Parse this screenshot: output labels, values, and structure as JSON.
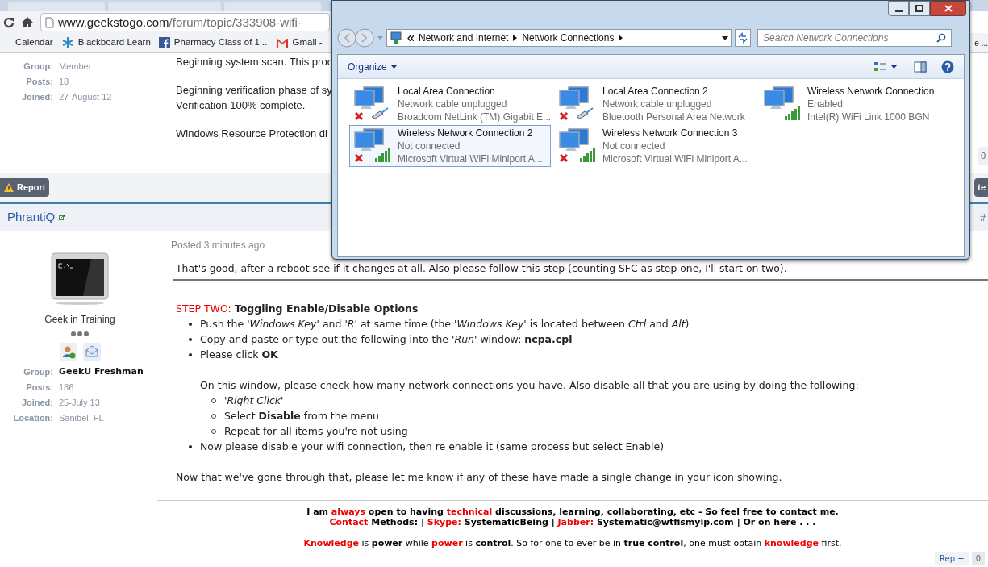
{
  "browser": {
    "url_host": "www.geekstogo.com",
    "url_path": "/forum/topic/333908-wifi-",
    "bookmarks": [
      {
        "label": "Calendar",
        "kind": "plain"
      },
      {
        "label": "Blackboard Learn",
        "kind": "tree"
      },
      {
        "label": "Pharmacy Class of 1...",
        "kind": "facebook"
      },
      {
        "label": "Gmail -",
        "kind": "mail"
      }
    ],
    "bookmark_tail": "e ..."
  },
  "posts": [
    {
      "info": [
        {
          "label": "Group:",
          "value": "Member",
          "emphasized": false
        },
        {
          "label": "Posts:",
          "value": "18",
          "emphasized": false
        },
        {
          "label": "Joined:",
          "value": "27-August 12",
          "emphasized": false
        }
      ],
      "paragraphs": [
        [
          "Beginning system scan. This proc"
        ],
        [
          "Beginning verification phase of sy",
          "Verification 100% complete."
        ],
        [
          "Windows Resource Protection di"
        ]
      ],
      "side_count": "0",
      "report": "Report",
      "side_button": "te"
    },
    {
      "author": "PhrantiQ",
      "header_tail": "#",
      "rank": "Geek in Training",
      "info": [
        {
          "label": "Group:",
          "value": "GeekU Freshman",
          "emphasized": true
        },
        {
          "label": "Posts:",
          "value": "186",
          "emphasized": false
        },
        {
          "label": "Joined:",
          "value": "25-July 13",
          "emphasized": false
        },
        {
          "label": "Location:",
          "value": "Sanibel, FL",
          "emphasized": false
        }
      ],
      "posted": "Posted 3 minutes ago",
      "intro": "That's good, after a reboot see if it changes at all. Also please follow this step (counting SFC as step one, I'll start on two).",
      "step_label": "STEP TWO:",
      "step_title": "Toggling Enable/Disable Options",
      "steps": [
        {
          "text": "Push the *'Windows Key'* and *'R'* at same time (the *'Windows Key'* is located between *Ctrl* and *Alt*)"
        },
        {
          "text": "Copy and paste or type out the following into the *'Run'* window: **ncpa.cpl**"
        },
        {
          "text": "Please click **OK**",
          "note": "On this window, please check how many network connections you have. Also disable all that you are using by doing the following:",
          "children": [
            {
              "text": "*'Right Click'*"
            },
            {
              "text": "Select **Disable** from the menu"
            },
            {
              "text": "Repeat for all items you're not using"
            }
          ]
        },
        {
          "text": "Now please disable your wifi connection, then re enable it (same process but select Enable)"
        }
      ],
      "closing": "Now that we've gone through that, please let me know if any of these have made a single change in your icon showing.",
      "signature": [
        {
          "bold": true,
          "segments": [
            {
              "text": "I am ",
              "accent": false
            },
            {
              "text": "always",
              "accent": true
            },
            {
              "text": " open to having ",
              "accent": false
            },
            {
              "text": "technical",
              "accent": true
            },
            {
              "text": " discussions, learning, collaborating, etc - So feel free to contact me.",
              "accent": false
            }
          ]
        },
        {
          "bold": true,
          "segments": [
            {
              "text": "Contact",
              "accent": true
            },
            {
              "text": " Methods: | ",
              "accent": false
            },
            {
              "text": "Skype:",
              "accent": true
            },
            {
              "text": " SystematicBeing | ",
              "accent": false
            },
            {
              "text": "Jabber:",
              "accent": true
            },
            {
              "text": " Systematic@wtfismyip.com | Or on here . . .",
              "accent": false
            }
          ]
        },
        {
          "bold": false,
          "segments": [
            {
              "text": "**Knowledge**",
              "accent": true
            },
            {
              "text": " is **power** while ",
              "accent": false
            },
            {
              "text": "**power**",
              "accent": true
            },
            {
              "text": " is **control**. So for one to ever be in **true control**, one must obtain ",
              "accent": false
            },
            {
              "text": "**knowledge**",
              "accent": true
            },
            {
              "text": " first.",
              "accent": false
            }
          ]
        }
      ],
      "rep_label": "Rep +",
      "rep_count": "0"
    }
  ],
  "explorer": {
    "breadcrumb": [
      "Network and Internet",
      "Network Connections"
    ],
    "search_placeholder": "Search Network Connections",
    "organize": "Organize",
    "connections": [
      {
        "name": "Local Area Connection",
        "status": "Network cable unplugged",
        "device": "Broadcom NetLink (TM) Gigabit E...",
        "kind": "wired",
        "disabled": true,
        "selected": false
      },
      {
        "name": "Local Area Connection 2",
        "status": "Network cable unplugged",
        "device": "Bluetooth Personal Area Network",
        "kind": "wired",
        "disabled": true,
        "selected": false
      },
      {
        "name": "Wireless Network Connection",
        "status": "Enabled",
        "device": "Intel(R) WiFi Link 1000 BGN",
        "kind": "wireless",
        "disabled": false,
        "selected": false
      },
      {
        "name": "Wireless Network Connection 2",
        "status": "Not connected",
        "device": "Microsoft Virtual WiFi Miniport A...",
        "kind": "wireless",
        "disabled": true,
        "selected": true
      },
      {
        "name": "Wireless Network Connection 3",
        "status": "Not connected",
        "device": "Microsoft Virtual WiFi Miniport A...",
        "kind": "wireless",
        "disabled": true,
        "selected": false
      }
    ]
  }
}
